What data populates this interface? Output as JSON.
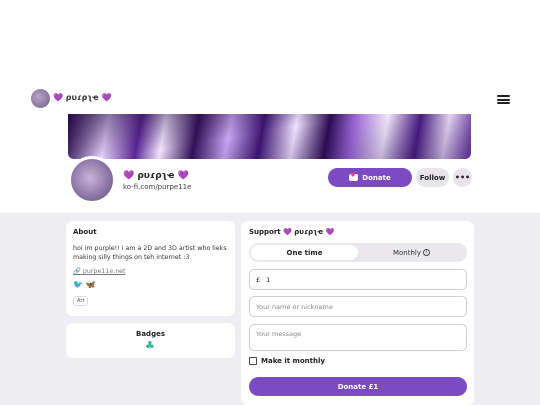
{
  "header": {
    "brand_name": "💜 ρυɾρʅҽ 💜",
    "menu_icon": "hamburger-icon"
  },
  "profile": {
    "name": "💜 ρυɾρʅҽ 💜",
    "url": "ko-fi.com/purpe11e",
    "donate_label": "Donate",
    "follow_label": "Follow",
    "more_label": "•••"
  },
  "about": {
    "title": "About",
    "bio": "hoi im purple!! i am a 2D and 3D artist who lieks making silly things on teh internet :3",
    "link": "purpe11e.net",
    "social_icons": [
      "twitter-icon",
      "butterfly-icon"
    ],
    "tag": "Art"
  },
  "badges": {
    "title": "Badges",
    "badge_icon": "clover-icon",
    "badge_color": "#2fb3a0"
  },
  "support": {
    "title": "Support 💜 ρυɾρʅҽ 💜",
    "tab_one_time": "One time",
    "tab_monthly": "Monthly",
    "currency": "£",
    "amount": "1",
    "name_placeholder": "Your name or nickname",
    "message_placeholder": "Your message",
    "monthly_checkbox_label": "Make it monthly",
    "submit_label": "Donate £1"
  },
  "colors": {
    "accent": "#7c4bc4",
    "background_gray": "#eeedf2"
  }
}
